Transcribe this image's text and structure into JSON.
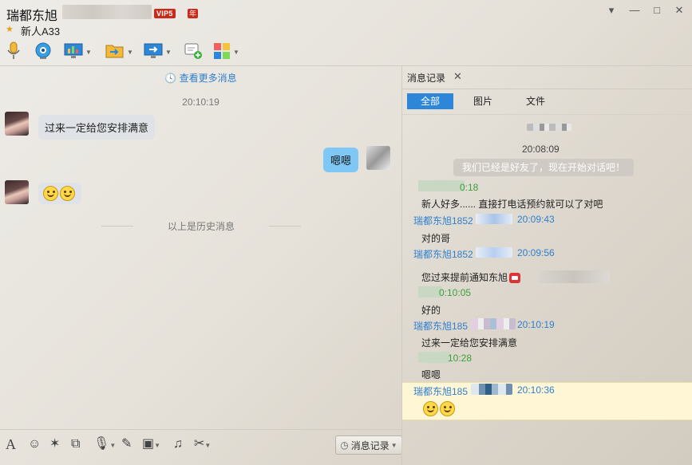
{
  "window": {
    "title": "瑞都东旭",
    "vip_label": "VIP5",
    "year_label": "年",
    "subtitle": "新人A33",
    "controls": {
      "menu": "▾",
      "minimize": "—",
      "maximize": "□",
      "close": "✕"
    }
  },
  "toolbar": {
    "items": [
      "mic-icon",
      "camera-icon",
      "screen-share-icon",
      "file-transfer-icon",
      "remote-desktop-icon",
      "message-add-icon",
      "apps-icon"
    ]
  },
  "chat": {
    "more_link": "查看更多消息",
    "time1": "20:10:19",
    "msg1": "过来一定给您安排满意",
    "msg2": "嗯嗯",
    "history_label": "以上是历史消息"
  },
  "input_toolbar": {
    "history_button": "消息记录"
  },
  "panel": {
    "tab_label": "消息记录",
    "filters": [
      "全部",
      "图片",
      "文件"
    ],
    "time_header": "20:08:09",
    "system_msg": "我们已经是好友了，现在开始对话吧！",
    "entries": [
      {
        "sender": "0:18",
        "green": true,
        "text": "新人好多...... 直接打电话预约就可以了对吧"
      },
      {
        "sender": "瑞都东旭1852",
        "time": "20:09:43",
        "green": false,
        "text": "对的哥"
      },
      {
        "sender": "瑞都东旭1852",
        "time": "20:09:56",
        "green": false,
        "text": "您过来提前通知东旭"
      },
      {
        "sender": "0:10:05",
        "green": true,
        "text": "好的"
      },
      {
        "sender": "瑞都东旭185",
        "time": "20:10:19",
        "green": false,
        "text": "过来一定给您安排满意"
      },
      {
        "sender": "10:28",
        "green": true,
        "text": "嗯嗯"
      },
      {
        "sender": "瑞都东旭185",
        "time": "20:10:36",
        "green": false,
        "text": ""
      }
    ]
  },
  "colors": {
    "accent": "#2e86d8",
    "bubble_out": "#7fc8f6",
    "bubble_in": "#dfe2e7",
    "vip": "#c92a1a"
  }
}
